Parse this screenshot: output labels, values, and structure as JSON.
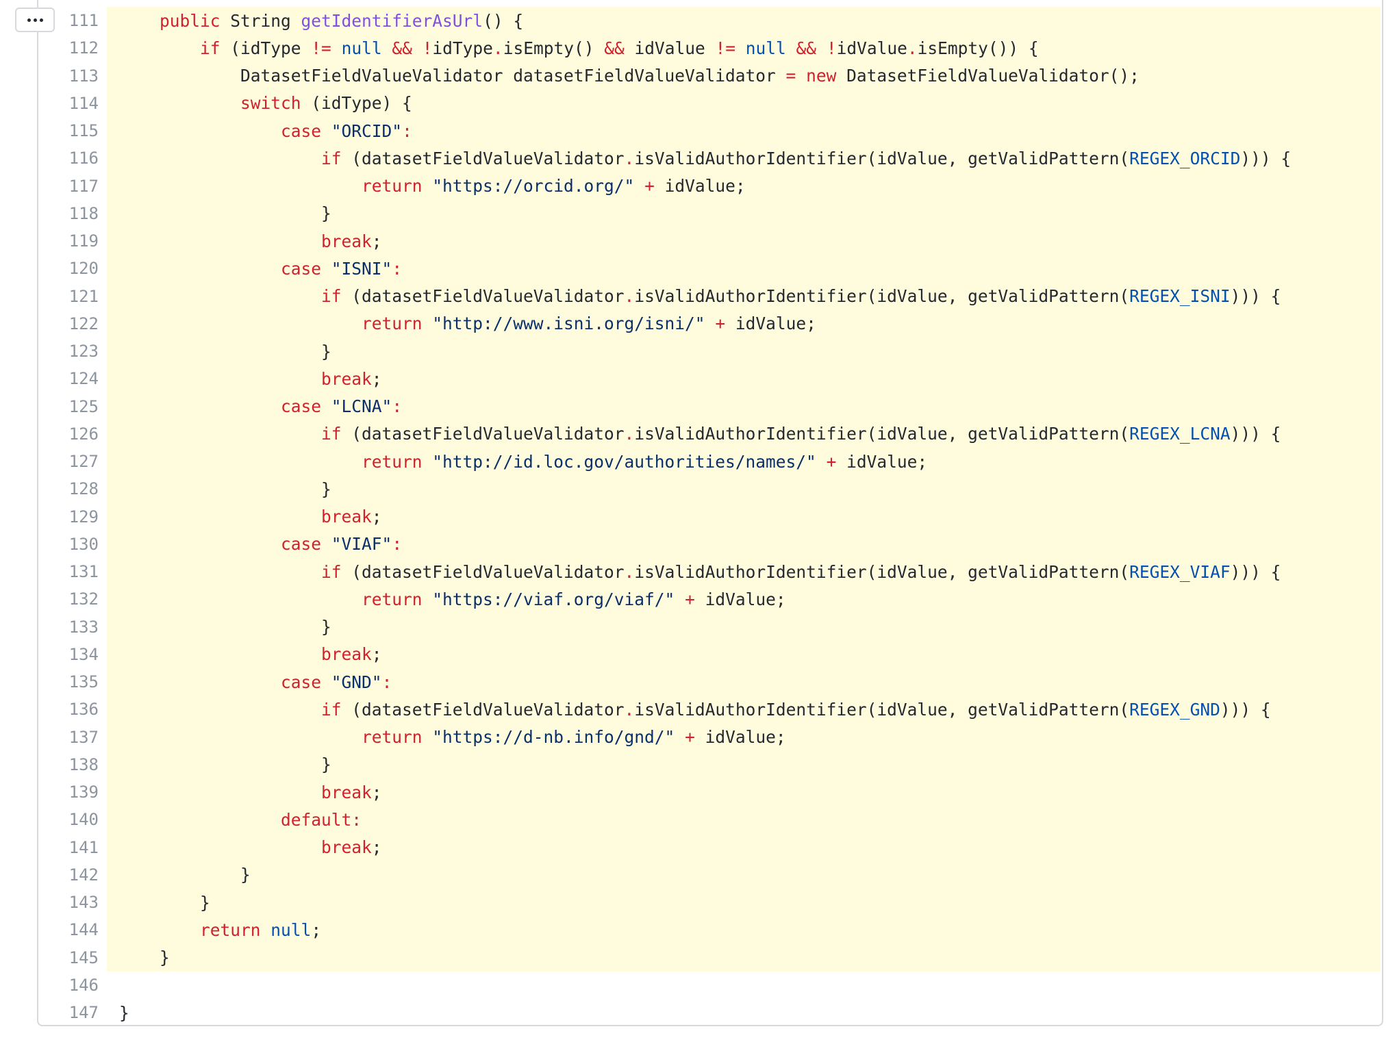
{
  "expand_button": {
    "label": "..."
  },
  "colors": {
    "highlight_background": "#fffbdd",
    "keyword": "#cf222e",
    "function": "#8250df",
    "constant": "#0550ae",
    "string": "#0a3069",
    "plain": "#24292f",
    "line_number": "#8c959f",
    "border": "#d6d9dd"
  },
  "lines": [
    {
      "num": "111",
      "hl": true,
      "tokens": [
        [
          "pl",
          "    "
        ],
        [
          "kw",
          "public"
        ],
        [
          "pl",
          " String "
        ],
        [
          "fn",
          "getIdentifierAsUrl"
        ],
        [
          "pl",
          "() {"
        ]
      ]
    },
    {
      "num": "112",
      "hl": true,
      "tokens": [
        [
          "pl",
          "        "
        ],
        [
          "kw",
          "if"
        ],
        [
          "pl",
          " (idType "
        ],
        [
          "op",
          "!="
        ],
        [
          "pl",
          " "
        ],
        [
          "cn",
          "null"
        ],
        [
          "pl",
          " "
        ],
        [
          "op",
          "&&"
        ],
        [
          "pl",
          " "
        ],
        [
          "op",
          "!"
        ],
        [
          "pl",
          "idType"
        ],
        [
          "op",
          "."
        ],
        [
          "pl",
          "isEmpty() "
        ],
        [
          "op",
          "&&"
        ],
        [
          "pl",
          " idValue "
        ],
        [
          "op",
          "!="
        ],
        [
          "pl",
          " "
        ],
        [
          "cn",
          "null"
        ],
        [
          "pl",
          " "
        ],
        [
          "op",
          "&&"
        ],
        [
          "pl",
          " "
        ],
        [
          "op",
          "!"
        ],
        [
          "pl",
          "idValue"
        ],
        [
          "op",
          "."
        ],
        [
          "pl",
          "isEmpty()) {"
        ]
      ]
    },
    {
      "num": "113",
      "hl": true,
      "tokens": [
        [
          "pl",
          "            DatasetFieldValueValidator datasetFieldValueValidator "
        ],
        [
          "op",
          "="
        ],
        [
          "pl",
          " "
        ],
        [
          "kw",
          "new"
        ],
        [
          "pl",
          " DatasetFieldValueValidator();"
        ]
      ]
    },
    {
      "num": "114",
      "hl": true,
      "tokens": [
        [
          "pl",
          "            "
        ],
        [
          "kw",
          "switch"
        ],
        [
          "pl",
          " (idType) {"
        ]
      ]
    },
    {
      "num": "115",
      "hl": true,
      "tokens": [
        [
          "pl",
          "                "
        ],
        [
          "kw",
          "case"
        ],
        [
          "pl",
          " "
        ],
        [
          "st",
          "\"ORCID\""
        ],
        [
          "kw",
          ":"
        ]
      ]
    },
    {
      "num": "116",
      "hl": true,
      "tokens": [
        [
          "pl",
          "                    "
        ],
        [
          "kw",
          "if"
        ],
        [
          "pl",
          " (datasetFieldValueValidator"
        ],
        [
          "op",
          "."
        ],
        [
          "pl",
          "isValidAuthorIdentifier(idValue, getValidPattern("
        ],
        [
          "cn",
          "REGEX_ORCID"
        ],
        [
          "pl",
          "))) {"
        ]
      ]
    },
    {
      "num": "117",
      "hl": true,
      "tokens": [
        [
          "pl",
          "                        "
        ],
        [
          "kw",
          "return"
        ],
        [
          "pl",
          " "
        ],
        [
          "st",
          "\"https://orcid.org/\""
        ],
        [
          "pl",
          " "
        ],
        [
          "op",
          "+"
        ],
        [
          "pl",
          " idValue;"
        ]
      ]
    },
    {
      "num": "118",
      "hl": true,
      "tokens": [
        [
          "pl",
          "                    }"
        ]
      ]
    },
    {
      "num": "119",
      "hl": true,
      "tokens": [
        [
          "pl",
          "                    "
        ],
        [
          "kw",
          "break"
        ],
        [
          "pl",
          ";"
        ]
      ]
    },
    {
      "num": "120",
      "hl": true,
      "tokens": [
        [
          "pl",
          "                "
        ],
        [
          "kw",
          "case"
        ],
        [
          "pl",
          " "
        ],
        [
          "st",
          "\"ISNI\""
        ],
        [
          "kw",
          ":"
        ]
      ]
    },
    {
      "num": "121",
      "hl": true,
      "tokens": [
        [
          "pl",
          "                    "
        ],
        [
          "kw",
          "if"
        ],
        [
          "pl",
          " (datasetFieldValueValidator"
        ],
        [
          "op",
          "."
        ],
        [
          "pl",
          "isValidAuthorIdentifier(idValue, getValidPattern("
        ],
        [
          "cn",
          "REGEX_ISNI"
        ],
        [
          "pl",
          "))) {"
        ]
      ]
    },
    {
      "num": "122",
      "hl": true,
      "tokens": [
        [
          "pl",
          "                        "
        ],
        [
          "kw",
          "return"
        ],
        [
          "pl",
          " "
        ],
        [
          "st",
          "\"http://www.isni.org/isni/\""
        ],
        [
          "pl",
          " "
        ],
        [
          "op",
          "+"
        ],
        [
          "pl",
          " idValue;"
        ]
      ]
    },
    {
      "num": "123",
      "hl": true,
      "tokens": [
        [
          "pl",
          "                    }"
        ]
      ]
    },
    {
      "num": "124",
      "hl": true,
      "tokens": [
        [
          "pl",
          "                    "
        ],
        [
          "kw",
          "break"
        ],
        [
          "pl",
          ";"
        ]
      ]
    },
    {
      "num": "125",
      "hl": true,
      "tokens": [
        [
          "pl",
          "                "
        ],
        [
          "kw",
          "case"
        ],
        [
          "pl",
          " "
        ],
        [
          "st",
          "\"LCNA\""
        ],
        [
          "kw",
          ":"
        ]
      ]
    },
    {
      "num": "126",
      "hl": true,
      "tokens": [
        [
          "pl",
          "                    "
        ],
        [
          "kw",
          "if"
        ],
        [
          "pl",
          " (datasetFieldValueValidator"
        ],
        [
          "op",
          "."
        ],
        [
          "pl",
          "isValidAuthorIdentifier(idValue, getValidPattern("
        ],
        [
          "cn",
          "REGEX_LCNA"
        ],
        [
          "pl",
          "))) {"
        ]
      ]
    },
    {
      "num": "127",
      "hl": true,
      "tokens": [
        [
          "pl",
          "                        "
        ],
        [
          "kw",
          "return"
        ],
        [
          "pl",
          " "
        ],
        [
          "st",
          "\"http://id.loc.gov/authorities/names/\""
        ],
        [
          "pl",
          " "
        ],
        [
          "op",
          "+"
        ],
        [
          "pl",
          " idValue;"
        ]
      ]
    },
    {
      "num": "128",
      "hl": true,
      "tokens": [
        [
          "pl",
          "                    }"
        ]
      ]
    },
    {
      "num": "129",
      "hl": true,
      "tokens": [
        [
          "pl",
          "                    "
        ],
        [
          "kw",
          "break"
        ],
        [
          "pl",
          ";"
        ]
      ]
    },
    {
      "num": "130",
      "hl": true,
      "tokens": [
        [
          "pl",
          "                "
        ],
        [
          "kw",
          "case"
        ],
        [
          "pl",
          " "
        ],
        [
          "st",
          "\"VIAF\""
        ],
        [
          "kw",
          ":"
        ]
      ]
    },
    {
      "num": "131",
      "hl": true,
      "tokens": [
        [
          "pl",
          "                    "
        ],
        [
          "kw",
          "if"
        ],
        [
          "pl",
          " (datasetFieldValueValidator"
        ],
        [
          "op",
          "."
        ],
        [
          "pl",
          "isValidAuthorIdentifier(idValue, getValidPattern("
        ],
        [
          "cn",
          "REGEX_VIAF"
        ],
        [
          "pl",
          "))) {"
        ]
      ]
    },
    {
      "num": "132",
      "hl": true,
      "tokens": [
        [
          "pl",
          "                        "
        ],
        [
          "kw",
          "return"
        ],
        [
          "pl",
          " "
        ],
        [
          "st",
          "\"https://viaf.org/viaf/\""
        ],
        [
          "pl",
          " "
        ],
        [
          "op",
          "+"
        ],
        [
          "pl",
          " idValue;"
        ]
      ]
    },
    {
      "num": "133",
      "hl": true,
      "tokens": [
        [
          "pl",
          "                    }"
        ]
      ]
    },
    {
      "num": "134",
      "hl": true,
      "tokens": [
        [
          "pl",
          "                    "
        ],
        [
          "kw",
          "break"
        ],
        [
          "pl",
          ";"
        ]
      ]
    },
    {
      "num": "135",
      "hl": true,
      "tokens": [
        [
          "pl",
          "                "
        ],
        [
          "kw",
          "case"
        ],
        [
          "pl",
          " "
        ],
        [
          "st",
          "\"GND\""
        ],
        [
          "kw",
          ":"
        ]
      ]
    },
    {
      "num": "136",
      "hl": true,
      "tokens": [
        [
          "pl",
          "                    "
        ],
        [
          "kw",
          "if"
        ],
        [
          "pl",
          " (datasetFieldValueValidator"
        ],
        [
          "op",
          "."
        ],
        [
          "pl",
          "isValidAuthorIdentifier(idValue, getValidPattern("
        ],
        [
          "cn",
          "REGEX_GND"
        ],
        [
          "pl",
          "))) {"
        ]
      ]
    },
    {
      "num": "137",
      "hl": true,
      "tokens": [
        [
          "pl",
          "                        "
        ],
        [
          "kw",
          "return"
        ],
        [
          "pl",
          " "
        ],
        [
          "st",
          "\"https://d-nb.info/gnd/\""
        ],
        [
          "pl",
          " "
        ],
        [
          "op",
          "+"
        ],
        [
          "pl",
          " idValue;"
        ]
      ]
    },
    {
      "num": "138",
      "hl": true,
      "tokens": [
        [
          "pl",
          "                    }"
        ]
      ]
    },
    {
      "num": "139",
      "hl": true,
      "tokens": [
        [
          "pl",
          "                    "
        ],
        [
          "kw",
          "break"
        ],
        [
          "pl",
          ";"
        ]
      ]
    },
    {
      "num": "140",
      "hl": true,
      "tokens": [
        [
          "pl",
          "                "
        ],
        [
          "kw",
          "default:"
        ]
      ]
    },
    {
      "num": "141",
      "hl": true,
      "tokens": [
        [
          "pl",
          "                    "
        ],
        [
          "kw",
          "break"
        ],
        [
          "pl",
          ";"
        ]
      ]
    },
    {
      "num": "142",
      "hl": true,
      "tokens": [
        [
          "pl",
          "            }"
        ]
      ]
    },
    {
      "num": "143",
      "hl": true,
      "tokens": [
        [
          "pl",
          "        }"
        ]
      ]
    },
    {
      "num": "144",
      "hl": true,
      "tokens": [
        [
          "pl",
          "        "
        ],
        [
          "kw",
          "return"
        ],
        [
          "pl",
          " "
        ],
        [
          "cn",
          "null"
        ],
        [
          "pl",
          ";"
        ]
      ]
    },
    {
      "num": "145",
      "hl": true,
      "tokens": [
        [
          "pl",
          "    }"
        ]
      ]
    },
    {
      "num": "146",
      "hl": false,
      "tokens": [
        [
          "pl",
          ""
        ]
      ]
    },
    {
      "num": "147",
      "hl": false,
      "tokens": [
        [
          "pl",
          "}"
        ]
      ]
    }
  ]
}
